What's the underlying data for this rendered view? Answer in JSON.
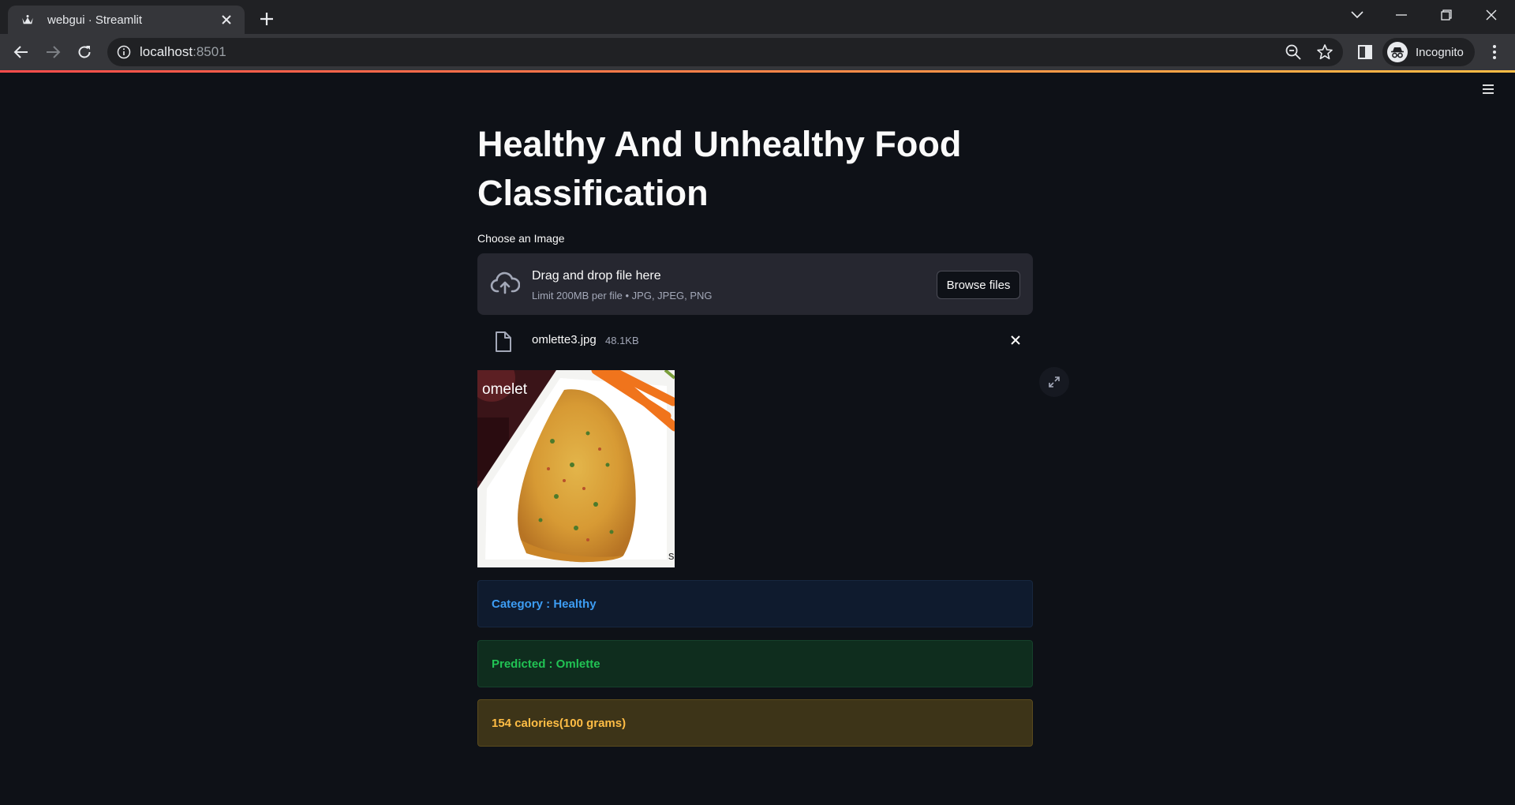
{
  "browser": {
    "tab_title": "webgui · Streamlit",
    "url_host": "localhost",
    "url_port": ":8501",
    "profile_label": "Incognito"
  },
  "page": {
    "title": "Healthy And Unhealthy Food Classification",
    "uploader": {
      "label": "Choose an Image",
      "drop_title": "Drag and drop file here",
      "drop_subtitle": "Limit 200MB per file • JPG, JPEG, PNG",
      "browse_label": "Browse files"
    },
    "uploaded_file": {
      "name": "omlette3.jpg",
      "size": "48.1KB"
    },
    "image": {
      "overlay_text": "omelet",
      "corner_text": "s"
    },
    "results": {
      "category": "Category : Healthy",
      "predicted": "Predicted : Omlette",
      "calories": "154 calories(100 grams)"
    }
  },
  "colors": {
    "background": "#0e1117",
    "info": "#3d9df3",
    "success": "#21c354",
    "warning": "#ffbd45"
  },
  "icons": [
    "streamlit-favicon",
    "close-icon",
    "plus-icon",
    "chevron-down-icon",
    "minimize-icon",
    "restore-icon",
    "back-icon",
    "forward-icon",
    "reload-icon",
    "info-icon",
    "zoom-out-icon",
    "star-icon",
    "side-panel-icon",
    "incognito-icon",
    "more-vert-icon",
    "hamburger-icon",
    "cloud-upload-icon",
    "file-icon",
    "fullscreen-icon"
  ]
}
